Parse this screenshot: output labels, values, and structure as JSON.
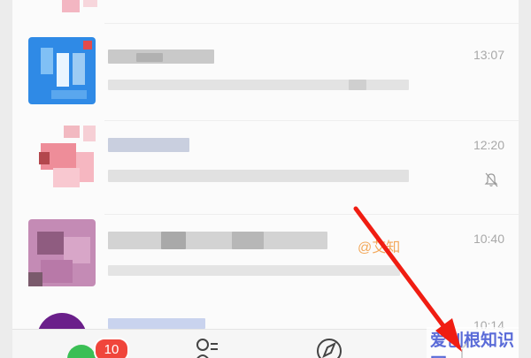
{
  "chats": [
    {
      "time": "13:07"
    },
    {
      "time": "12:20",
      "muted": true
    },
    {
      "time": "10:40",
      "mention": "@艾知"
    },
    {
      "time": "10:14"
    }
  ],
  "tabbar": {
    "items": [
      {
        "icon": "chat-icon",
        "badge": "10"
      },
      {
        "icon": "contacts-icon"
      },
      {
        "icon": "compass-icon"
      },
      {
        "icon": "profile-icon"
      }
    ]
  },
  "annotation": {
    "color": "#f01d12"
  },
  "watermark": {
    "text": "爱创根知识网"
  }
}
